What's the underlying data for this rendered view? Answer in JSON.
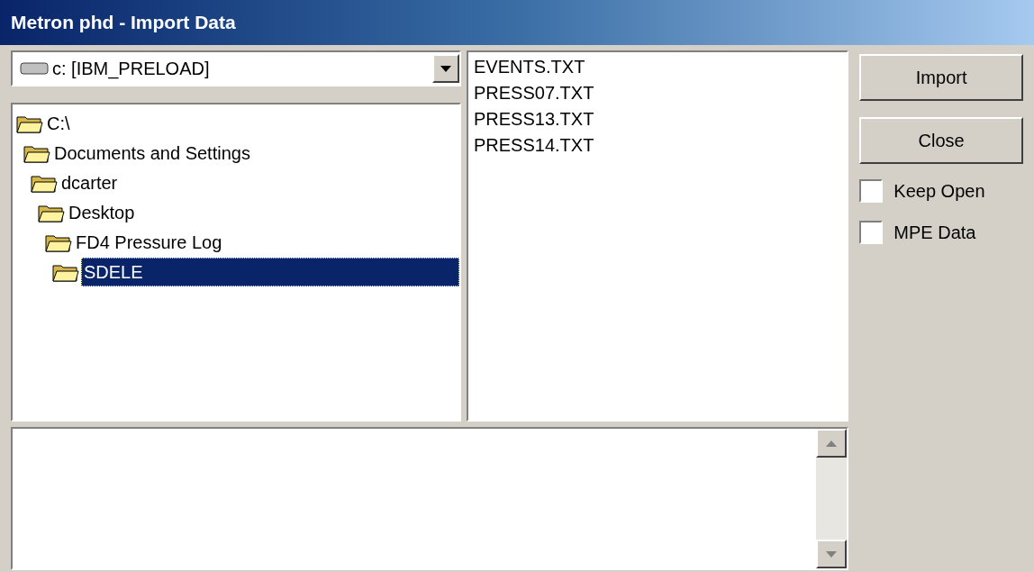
{
  "window": {
    "title": "Metron phd - Import Data"
  },
  "drive_select": {
    "value": "c: [IBM_PRELOAD]"
  },
  "folder_tree": [
    {
      "label": "C:\\",
      "selected": false,
      "children": [
        {
          "label": "Documents and Settings",
          "selected": false,
          "children": [
            {
              "label": "dcarter",
              "selected": false,
              "children": [
                {
                  "label": "Desktop",
                  "selected": false,
                  "children": [
                    {
                      "label": "FD4 Pressure Log",
                      "selected": false,
                      "children": [
                        {
                          "label": "SDELE",
                          "selected": true
                        }
                      ]
                    }
                  ]
                }
              ]
            }
          ]
        }
      ]
    }
  ],
  "files": [
    {
      "name": "EVENTS.TXT"
    },
    {
      "name": "PRESS07.TXT"
    },
    {
      "name": "PRESS13.TXT"
    },
    {
      "name": "PRESS14.TXT"
    }
  ],
  "buttons": [
    {
      "label": "Import"
    },
    {
      "label": "Close"
    }
  ],
  "checkboxes": [
    {
      "label": "Keep Open",
      "checked": false
    },
    {
      "label": "MPE Data",
      "checked": false
    }
  ]
}
